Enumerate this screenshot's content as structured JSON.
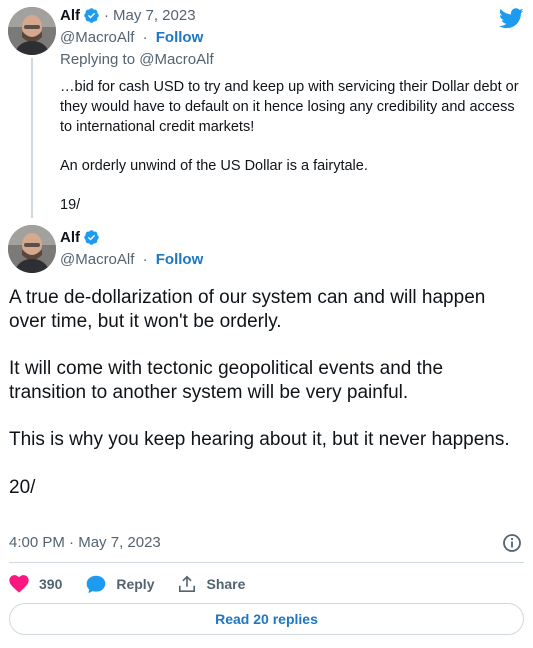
{
  "colors": {
    "link_blue": "#1d77c2",
    "twitter_blue": "#1d9bf0",
    "heart_red": "#f91880",
    "muted": "#536471",
    "border": "#cfd9de"
  },
  "tweet1": {
    "author_name": "Alf",
    "handle": "@MacroAlf",
    "date": "May 7, 2023",
    "follow_label": "Follow",
    "replying_prefix": "Replying to",
    "replying_handle": "@MacroAlf",
    "paragraphs": [
      "…bid for cash USD to try and keep up with servicing their Dollar debt or they would have to default on it hence losing any credibility and access to international credit markets!",
      "An orderly unwind of the US Dollar is a fairytale.",
      "19/"
    ]
  },
  "tweet2": {
    "author_name": "Alf",
    "handle": "@MacroAlf",
    "follow_label": "Follow",
    "paragraphs": [
      "A true de-dollarization of our system can and will happen over time, but it won't be orderly.",
      "It will come with tectonic geopolitical events and the transition to another system will be very painful.",
      "This is why you keep hearing about it, but it never happens.",
      "20/"
    ],
    "time": "4:00 PM",
    "date": "May 7, 2023"
  },
  "actions": {
    "like_count": "390",
    "reply_label": "Reply",
    "share_label": "Share",
    "read_replies_label": "Read 20 replies"
  },
  "icons": {
    "verified": "verified-badge-icon",
    "twitter": "twitter-bird-icon",
    "info": "info-icon",
    "heart": "heart-icon",
    "reply": "reply-bubble-icon",
    "share": "share-upload-icon"
  }
}
